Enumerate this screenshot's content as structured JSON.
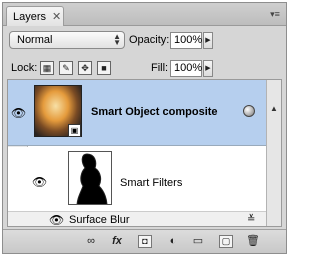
{
  "panel": {
    "tab_label": "Layers",
    "close_glyph": "✕",
    "menu_glyph": "▾≡"
  },
  "controls": {
    "blend_mode": "Normal",
    "opacity_label": "Opacity:",
    "opacity_value": "100%",
    "lock_label": "Lock:",
    "fill_label": "Fill:",
    "fill_value": "100%",
    "stepper_glyph": "▶"
  },
  "layers": [
    {
      "name": "Smart Object composite",
      "selected": true,
      "visible": true
    },
    {
      "name": "Smart Filters",
      "visible": true
    },
    {
      "name": "Surface Blur",
      "visible": true
    }
  ],
  "icons": {
    "eye": "👁",
    "smart_object_badge": "▣",
    "link": "∞",
    "fx": "fx",
    "mask": "◘",
    "adjustment": "◐",
    "folder": "▭",
    "new_layer": "▢",
    "trash": "🗑",
    "filter_options": "≚"
  },
  "colors": {
    "selection": "#b6cfee",
    "panel_bg": "#d6d6d6"
  }
}
